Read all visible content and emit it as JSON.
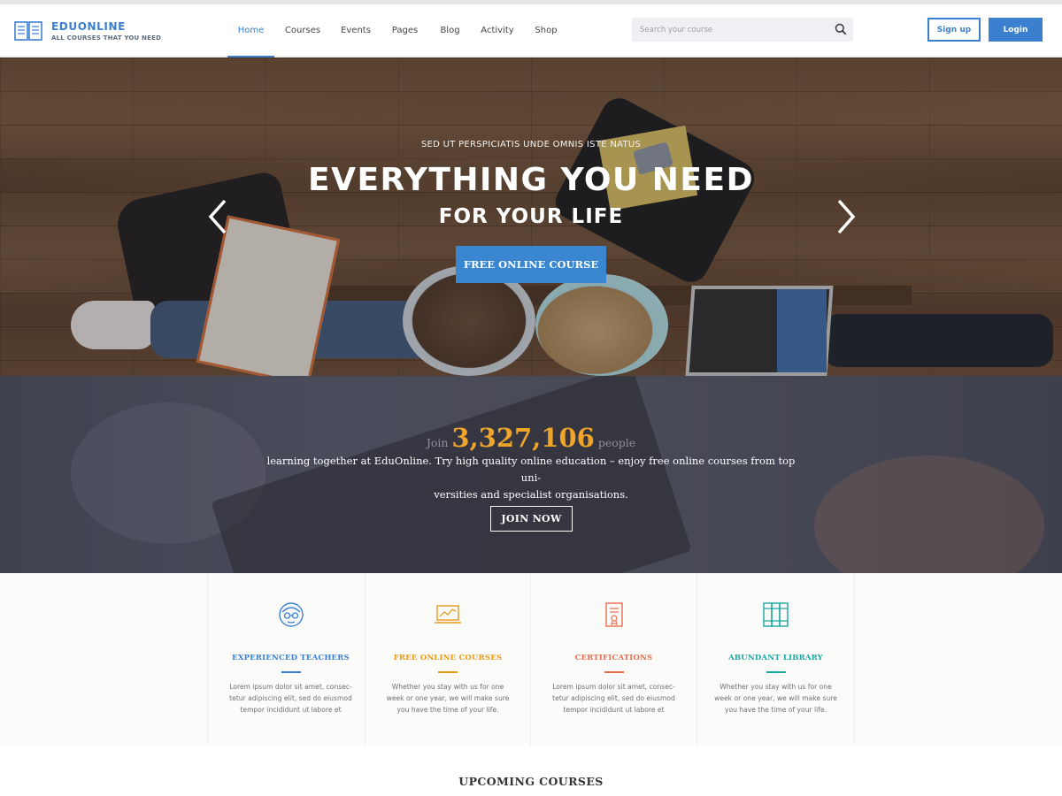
{
  "logo": {
    "name": "EDUONLINE",
    "tagline": "ALL COURSES THAT YOU NEED"
  },
  "nav": {
    "items": [
      {
        "label": "Home",
        "active": true
      },
      {
        "label": "Courses",
        "active": false
      },
      {
        "label": "Events",
        "active": false
      },
      {
        "label": "Pages",
        "active": false
      },
      {
        "label": "Blog",
        "active": false
      },
      {
        "label": "Activity",
        "active": false
      },
      {
        "label": "Shop",
        "active": false
      }
    ]
  },
  "search": {
    "placeholder": "Search your course",
    "value": ""
  },
  "auth": {
    "signup_label": "Sign up",
    "login_label": "Login"
  },
  "hero": {
    "kicker": "SED UT PERSPICIATIS UNDE OMNIS ISTE NATUS",
    "title": "EVERYTHING YOU NEED",
    "subtitle": "FOR YOUR LIFE",
    "cta_label": "FREE ONLINE COURSE"
  },
  "join": {
    "pre": "Join",
    "count": "3,327,106",
    "post": "people",
    "description_line1": "learning together at EduOnline. Try high quality online education – enjoy free online courses from top uni-",
    "description_line2": "versities and specialist organisations.",
    "button_label": "JOIN NOW"
  },
  "features": [
    {
      "icon": "teacher-icon",
      "title": "EXPERIENCED TEACHERS",
      "color": "#3a80cf",
      "text_line1": "Lorem ipsum dolor sit amet, consec-",
      "text_line2": "tetur adipiscing elit, sed do eiusmod",
      "text_line3": "tempor incididunt ut labore et"
    },
    {
      "icon": "laptop-chart-icon",
      "title": "FREE ONLINE COURSES",
      "color": "#e89a1c",
      "text_line1": "Whether you stay with us for one",
      "text_line2": "week or one year, we will make sure",
      "text_line3": "you have the time of your life."
    },
    {
      "icon": "certificate-icon",
      "title": "CERTIFICATIONS",
      "color": "#e86d4e",
      "text_line1": "Lorem ipsum dolor sit amet, consec-",
      "text_line2": "tetur adipiscing elit, sed do eiusmod",
      "text_line3": "tempor incididunt ut labore et"
    },
    {
      "icon": "books-icon",
      "title": "ABUNDANT LIBRARY",
      "color": "#1aa8a0",
      "text_line1": "Whether you stay with us for one",
      "text_line2": "week or one year, we will make sure",
      "text_line3": "you have the time of your life."
    }
  ],
  "upcoming": {
    "title": "UPCOMING COURSES"
  },
  "colors": {
    "accent": "#3a80cf",
    "highlight": "#f0a52a"
  }
}
